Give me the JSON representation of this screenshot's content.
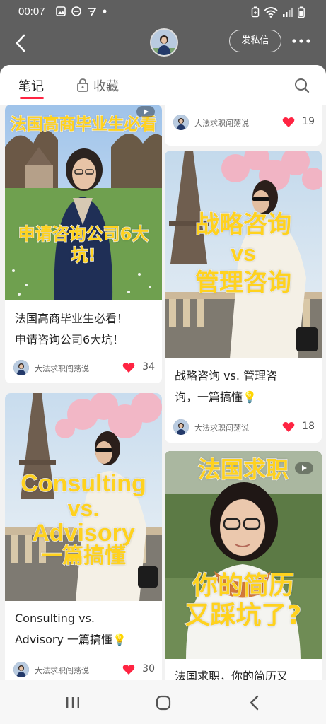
{
  "status_bar": {
    "time": "00:07"
  },
  "header": {
    "message_button": "发私信"
  },
  "tabs": {
    "notes": "笔记",
    "favorites": "收藏"
  },
  "feed": {
    "left": [
      {
        "overlay_top": "法国高商毕业生必看",
        "overlay_bottom": "申请咨询公司6大坑!",
        "title_line1": "法国高商毕业生必看！",
        "title_line2": "申请咨询公司6大坑！",
        "author": "大法求职闯荡说",
        "likes": "34"
      },
      {
        "overlay_line1": "Consulting",
        "overlay_line2": "vs.",
        "overlay_line3": "Advisory",
        "overlay_line4": "一篇搞懂",
        "title_line1": "Consulting vs.",
        "title_line2": "Advisory 一篇搞懂💡",
        "author": "大法求职闯荡说",
        "likes": "30"
      }
    ],
    "right": [
      {
        "author": "大法求职闯荡说",
        "likes": "19"
      },
      {
        "overlay_line1": "战略咨询",
        "overlay_line2": "vs",
        "overlay_line3": "管理咨询",
        "title_line1": "战略咨询 vs. 管理咨",
        "title_line2": "询，一篇搞懂💡",
        "author": "大法求职闯荡说",
        "likes": "18"
      },
      {
        "overlay_top": "法国求职",
        "overlay_bottom1": "你的简历",
        "overlay_bottom2": "又踩坑了?",
        "title_line1": "法国求职，你的简历又"
      }
    ]
  },
  "colors": {
    "accent": "#ff2442",
    "overlay_yellow": "#ffd21e"
  }
}
